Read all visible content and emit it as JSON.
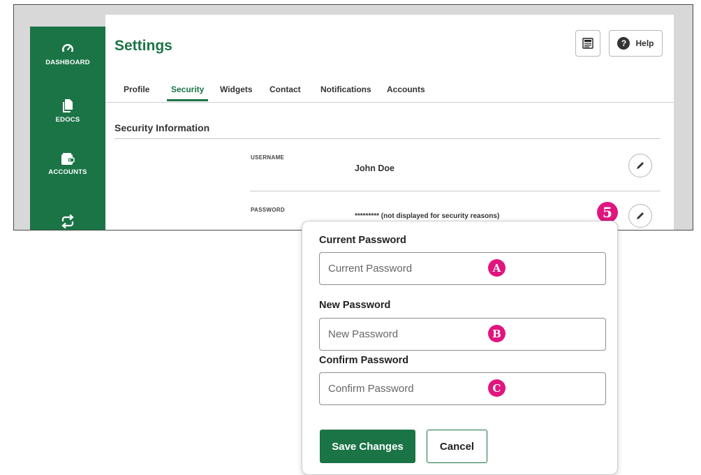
{
  "sidebar": {
    "items": [
      {
        "label": "DASHBOARD",
        "icon": "speedometer-icon"
      },
      {
        "label": "EDOCS",
        "icon": "documents-icon"
      },
      {
        "label": "ACCOUNTS",
        "icon": "wallet-icon"
      },
      {
        "label": "",
        "icon": "transfer-icon"
      }
    ]
  },
  "header": {
    "title": "Settings",
    "print_icon": "print-icon",
    "help_label": "Help",
    "help_icon_glyph": "?"
  },
  "tabs": [
    {
      "label": "Profile",
      "active": false
    },
    {
      "label": "Security",
      "active": true
    },
    {
      "label": "Widgets",
      "active": false
    },
    {
      "label": "Contact",
      "active": false
    },
    {
      "label": "Notifications",
      "active": false
    },
    {
      "label": "Accounts",
      "active": false
    }
  ],
  "security": {
    "section_title": "Security Information",
    "username": {
      "label": "USERNAME",
      "value": "John Doe"
    },
    "password": {
      "label": "PASSWORD",
      "value": "********* (not displayed for security reasons)"
    }
  },
  "step_markers": {
    "password_edit": "5",
    "current": "A",
    "new": "B",
    "confirm": "C"
  },
  "popup": {
    "current_label": "Current Password",
    "current_placeholder": "Current Password",
    "new_label": "New Password",
    "new_placeholder": "New Password",
    "confirm_label": "Confirm Password",
    "confirm_placeholder": "Confirm Password",
    "save_label": "Save Changes",
    "cancel_label": "Cancel"
  },
  "colors": {
    "brand_green": "#1b7446",
    "marker_pink": "#e0157f"
  }
}
